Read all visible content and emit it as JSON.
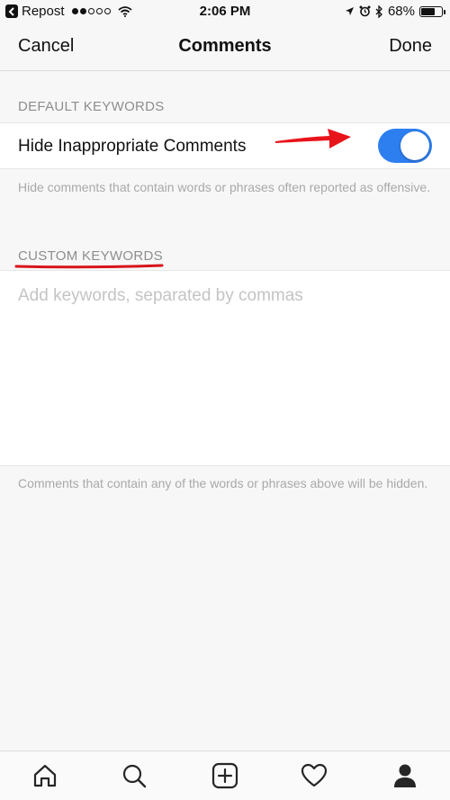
{
  "status_bar": {
    "back_app": "Repost",
    "time": "2:06 PM",
    "battery": "68%",
    "battery_level": 0.68
  },
  "nav": {
    "cancel": "Cancel",
    "title": "Comments",
    "done": "Done"
  },
  "default_keywords": {
    "header": "DEFAULT KEYWORDS",
    "toggle_label": "Hide Inappropriate Comments",
    "toggle_on": true,
    "toggle_color": "#2d7ff0",
    "footnote": "Hide comments that contain words or phrases often reported as offensive."
  },
  "custom_keywords": {
    "header": "CUSTOM KEYWORDS",
    "placeholder": "Add keywords, separated by commas",
    "value": "",
    "footnote": "Comments that contain any of the words or phrases above will be hidden."
  },
  "annotations": {
    "arrow_color": "#e8141b",
    "underline_color": "#d8141b"
  },
  "tab_bar": {
    "icons": [
      "home-icon",
      "search-icon",
      "add-post-icon",
      "heart-icon",
      "profile-icon"
    ]
  }
}
